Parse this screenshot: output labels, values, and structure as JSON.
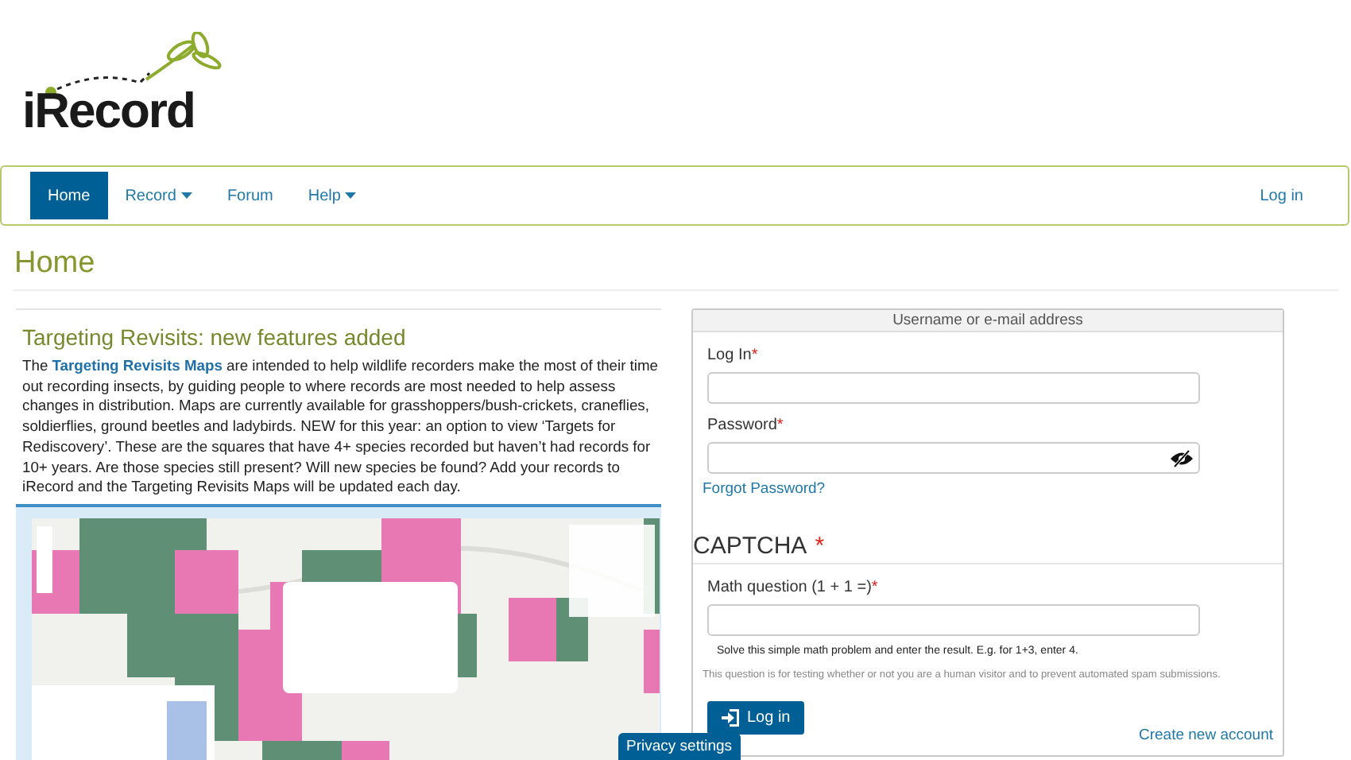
{
  "logo": {
    "text": "iRecord"
  },
  "nav": {
    "items": [
      {
        "label": "Home",
        "selected": true,
        "dropdown": false
      },
      {
        "label": "Record",
        "selected": false,
        "dropdown": true
      },
      {
        "label": "Forum",
        "selected": false,
        "dropdown": false
      },
      {
        "label": "Help",
        "selected": false,
        "dropdown": true
      }
    ],
    "login_link": "Log in"
  },
  "page_title": "Home",
  "article": {
    "title": "Targeting Revisits: new features added",
    "body_start": "The ",
    "link": "Targeting Revisits Maps",
    "body_end": " are intended to help wildlife recorders make the most of their time out recording insects, by guiding people to where records are most needed to help assess changes in distribution. Maps are currently available for grasshoppers/bush-crickets, craneflies, soldierflies, ground beetles and ladybirds. NEW for this year: an option to view ‘Targets for Rediscovery’. These are the squares that have 4+ species recorded but haven’t had records for 10+ years. Are those species still present? Will new species be found? Add your records to iRecord and the Targeting Revisits Maps will be updated each day."
  },
  "login": {
    "section_header": "Username or e-mail address",
    "fields": [
      {
        "label": "Log In",
        "required_mark": "*",
        "kind": "text"
      },
      {
        "label": "Password",
        "required_mark": "*",
        "kind": "password"
      }
    ],
    "forgot_link": "Forgot Password?",
    "captcha": {
      "title": "CAPTCHA",
      "required_mark": "*",
      "question": "Math question (1 + 1 =)",
      "question_mark": "*",
      "hint": "Solve this simple math problem and enter the result. E.g. for 1+3, enter 4.",
      "description": "This question is for testing whether or not you are a human visitor and to prevent automated spam submissions."
    },
    "submit": "Log in",
    "create_link": "Create new account"
  },
  "privacy_button": "Privacy settings"
}
